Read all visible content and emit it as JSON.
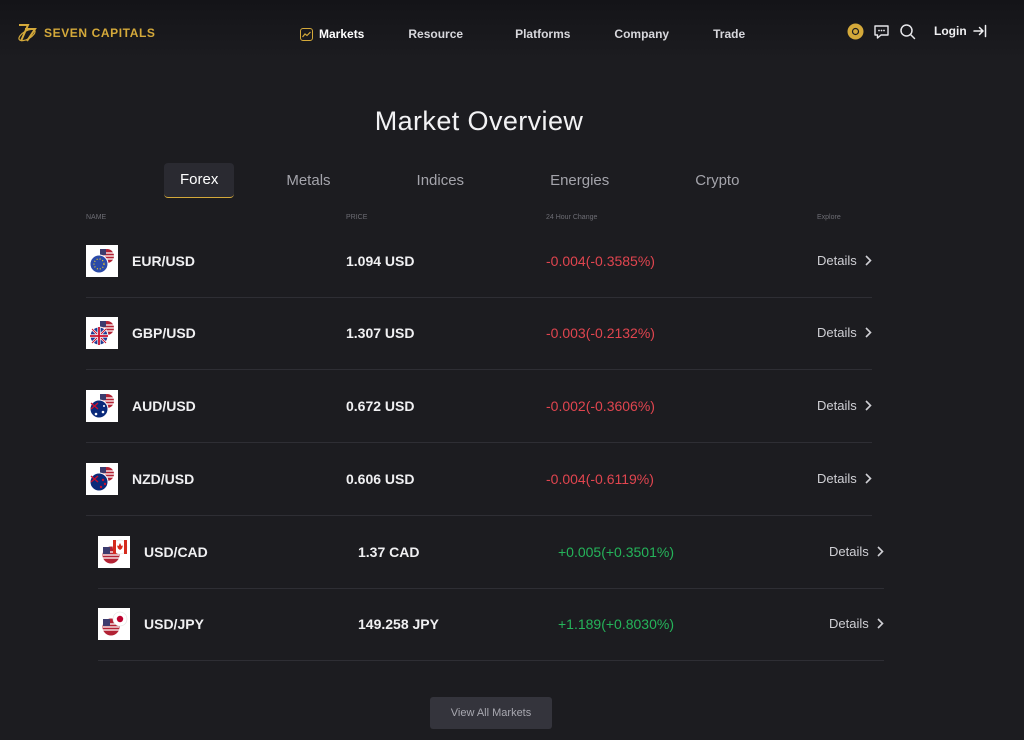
{
  "brand": {
    "name": "SEVEN CAPITALS"
  },
  "nav": {
    "items": [
      {
        "label": "Markets",
        "active": true
      },
      {
        "label": "Resource"
      },
      {
        "label": "Platforms"
      },
      {
        "label": "Company"
      },
      {
        "label": "Trade"
      }
    ],
    "login_label": "Login"
  },
  "colors": {
    "background": "#1c1c20",
    "accent_gold": "#d4a93a",
    "negative": "#e0454f",
    "positive": "#25b45a"
  },
  "icons": [
    "markets-chart-icon",
    "theme-toggle-icon",
    "chat-icon",
    "search-icon",
    "login-arrow-icon",
    "chevron-right-icon"
  ],
  "page": {
    "title": "Market Overview"
  },
  "tabs": [
    {
      "label": "Forex",
      "active": true
    },
    {
      "label": "Metals"
    },
    {
      "label": "Indices"
    },
    {
      "label": "Energies"
    },
    {
      "label": "Crypto"
    }
  ],
  "table": {
    "headers": {
      "name": "NAME",
      "price": "PRICE",
      "change": "24 Hour Change",
      "explore": "Explore"
    },
    "rows": [
      {
        "pair": "EUR/USD",
        "price": "1.094 USD",
        "change": "-0.004(-0.3585%)",
        "direction": "negative",
        "details": "Details"
      },
      {
        "pair": "GBP/USD",
        "price": "1.307 USD",
        "change": "-0.003(-0.2132%)",
        "direction": "negative",
        "details": "Details"
      },
      {
        "pair": "AUD/USD",
        "price": "0.672 USD",
        "change": "-0.002(-0.3606%)",
        "direction": "negative",
        "details": "Details"
      },
      {
        "pair": "NZD/USD",
        "price": "0.606 USD",
        "change": "-0.004(-0.6119%)",
        "direction": "negative",
        "details": "Details"
      },
      {
        "pair": "USD/CAD",
        "price": "1.37 CAD",
        "change": "+0.005(+0.3501%)",
        "direction": "positive",
        "details": "Details"
      },
      {
        "pair": "USD/JPY",
        "price": "149.258 JPY",
        "change": "+1.189(+0.8030%)",
        "direction": "positive",
        "details": "Details"
      }
    ]
  },
  "view_all_label": "View All Markets"
}
